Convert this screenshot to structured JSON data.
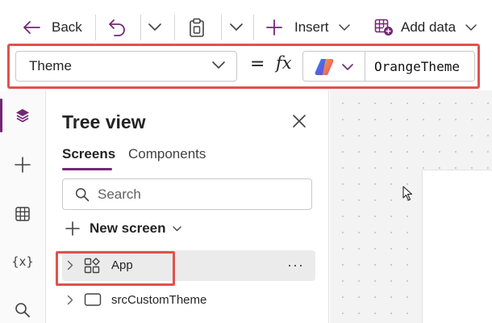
{
  "toolbar": {
    "back_label": "Back",
    "insert_label": "Insert",
    "add_data_label": "Add data"
  },
  "formula_bar": {
    "property_value": "Theme",
    "equals": "=",
    "fx": "fx",
    "formula_value": "OrangeTheme"
  },
  "tree_view": {
    "title": "Tree view",
    "tabs": [
      {
        "label": "Screens",
        "active": true
      },
      {
        "label": "Components",
        "active": false
      }
    ],
    "search_placeholder": "Search",
    "new_screen_label": "New screen",
    "items": [
      {
        "label": "App",
        "icon": "app-icon",
        "selected": true
      },
      {
        "label": "srcCustomTheme",
        "icon": "screen-icon",
        "selected": false
      }
    ],
    "more_glyph": "···"
  },
  "rail": {
    "items": [
      "layers-icon",
      "plus-icon",
      "table-icon",
      "variables-icon",
      "search-icon"
    ],
    "variables_glyph": "{x}"
  },
  "colors": {
    "accent": "#742774",
    "highlight": "#e0524f"
  }
}
